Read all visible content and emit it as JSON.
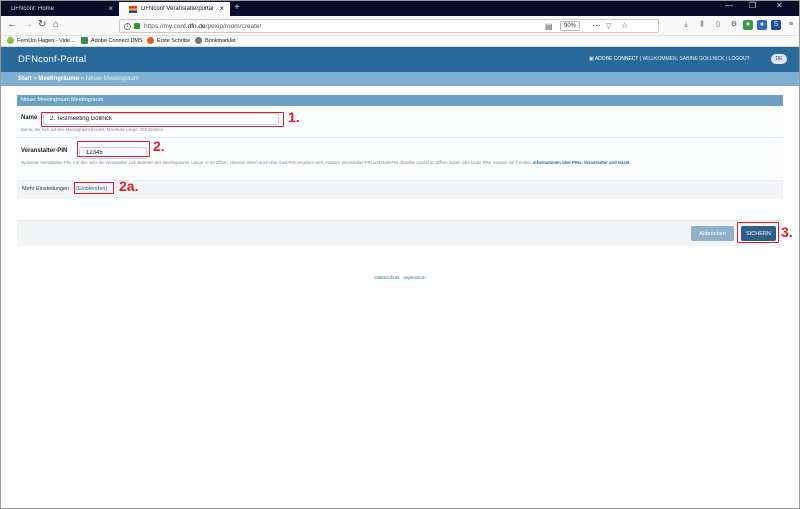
{
  "browser": {
    "tabs": [
      {
        "title": "DFNconf: Home",
        "active": false
      },
      {
        "title": "DFNconf Veranstalterportal",
        "active": true
      }
    ],
    "new_tab": "+",
    "window_controls": [
      "—",
      "❐",
      "✕"
    ],
    "url_prefix": "https://my.conf.",
    "url_domain": "dfn.de",
    "url_path": "/pexip/room/create/",
    "zoom": "90%",
    "bookmarks": [
      {
        "label": "FernUni Hagen - Vide...",
        "color": "#8bbf3f"
      },
      {
        "label": "Adobe Connect DMS",
        "color": "#3a8a5a"
      },
      {
        "label": "Erste Schritte",
        "color": "#e05a2a"
      },
      {
        "label": "Bookmarklet",
        "color": "#777777"
      }
    ]
  },
  "header": {
    "title": "DFNconf-Portal",
    "adobe_connect": "ADOBE CONNECT",
    "welcome": "WILLKOMMEN, SABINE GOLLNICK",
    "logout": "LOGOUT",
    "separator": "|",
    "lang": "DE"
  },
  "breadcrumb": {
    "start": "Start",
    "rooms": "Meetingräume",
    "current": "Neuer Meetingraum",
    "sep": "»"
  },
  "form": {
    "panel_title": "Neuer Meetingraum Meetingraum",
    "name_label": "Name",
    "name_value": "2. Testmeeting Gollnick",
    "name_help": "Name, der sich auf den Meetingraum bezieht. Maximale Länge: 250 Zeichen.",
    "pin_label": "Veranstalter-PIN",
    "pin_value": "12345",
    "pin_help": "Optionale Veranstalter-PIN. Für den oder die Veranstalter zum Betreten des Meetingraums. Länge: 4–20 Ziffern. Hinweis: Wenn auch eine Gast-PIN vergeben wird, müssen Veranstalter-PIN und Gast-PIN dieselbe Anzahl an Ziffern haben oder beide PINs müssen mit # enden.",
    "pin_help_link": "Informationen über PINs, Veranstalter und Gäste.",
    "more_label": "Mehr Einstellungen",
    "more_link": "(Einblenden)"
  },
  "actions": {
    "cancel": "Abbrechen",
    "save": "SICHERN"
  },
  "footer": {
    "privacy": "Datenschutz",
    "sep": "·",
    "imprint": "Impressum"
  },
  "annotations": {
    "step1": "1.",
    "step2": "2.",
    "step2a": "2a.",
    "step3": "3."
  }
}
